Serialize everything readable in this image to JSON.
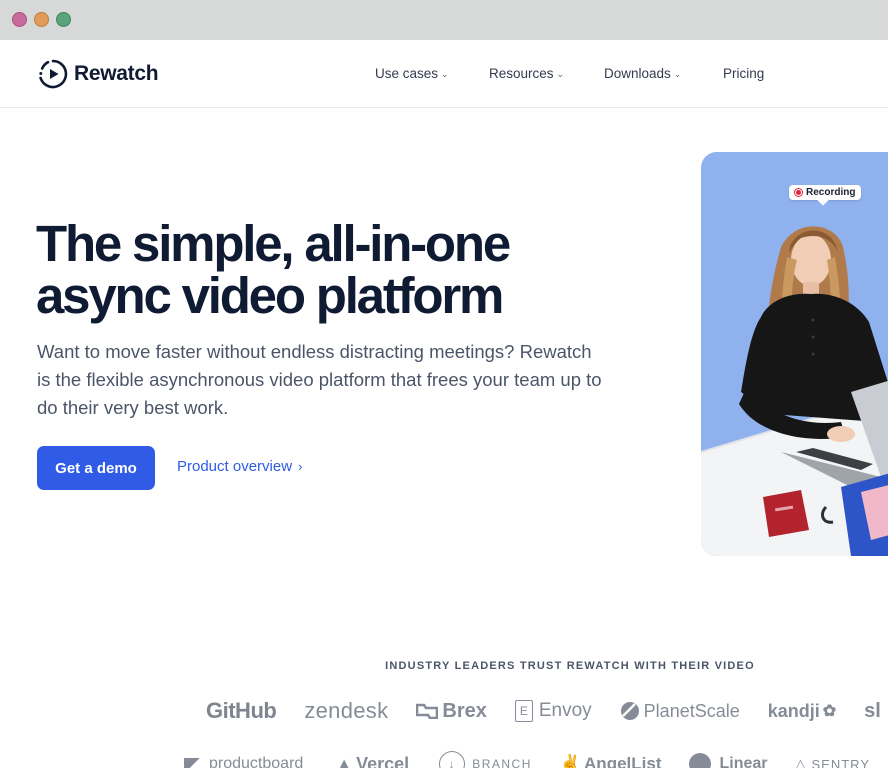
{
  "window": {
    "buttons": [
      "close",
      "minimize",
      "maximize"
    ]
  },
  "nav": {
    "brand": "Rewatch",
    "items": [
      {
        "label": "Use cases",
        "has_dropdown": true
      },
      {
        "label": "Resources",
        "has_dropdown": true
      },
      {
        "label": "Downloads",
        "has_dropdown": true
      },
      {
        "label": "Pricing",
        "has_dropdown": false
      }
    ]
  },
  "hero": {
    "title_line1": "The simple, all-in-one",
    "title_line2": "async video platform",
    "subtitle": "Want to move faster without endless distracting meetings? Rewatch is the flexible asynchronous video platform that frees your team up to do their very best work.",
    "cta_primary": "Get a demo",
    "cta_secondary": "Product overview",
    "image": {
      "badge": "Recording",
      "bg_color": "#8fb2ef"
    }
  },
  "trust": {
    "heading": "INDUSTRY LEADERS TRUST REWATCH WITH THEIR VIDEO",
    "row1": [
      "GitHub",
      "zendesk",
      "Brex",
      "Envoy",
      "PlanetScale",
      "kandji",
      "sl"
    ],
    "row2": [
      "productboard",
      "Vercel",
      "BRANCH",
      "AngelList",
      "Linear",
      "SENTRY"
    ]
  },
  "colors": {
    "accent": "#2f5be7",
    "heading": "#0f1a33",
    "body": "#4c5568"
  }
}
